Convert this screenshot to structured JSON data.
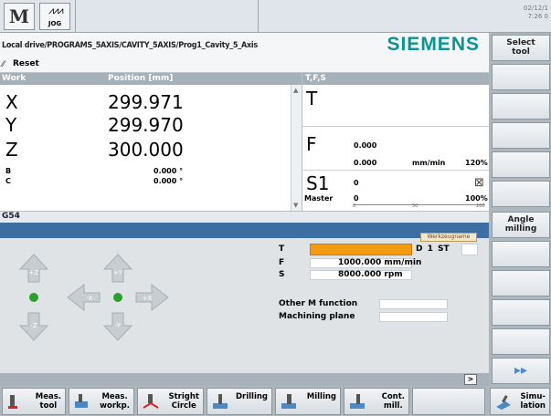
{
  "header": {
    "mode_icon": "M",
    "jog_label": "JOG",
    "date": "02/12/1",
    "time": "7:26 0"
  },
  "path": {
    "text": "Local drive/PROGRAMS_5AXIS/CAVITY_5AXIS/Prog1_Cavity_5_Axis",
    "brand": "SIEMENS",
    "reset": "Reset"
  },
  "work": {
    "header_work": "Work",
    "header_position": "Position [mm]",
    "axes": [
      {
        "name": "X",
        "value": "299.971"
      },
      {
        "name": "Y",
        "value": "299.970"
      },
      {
        "name": "Z",
        "value": "300.000"
      }
    ],
    "rot_axes": [
      {
        "name": "B",
        "value": "0.000 °"
      },
      {
        "name": "C",
        "value": "0.000 °"
      }
    ]
  },
  "tfs": {
    "header": "T,F,S",
    "t_label": "T",
    "f_label": "F",
    "f_actual": "0.000",
    "f_set": "0.000",
    "f_unit": "mm/min",
    "f_percent": "120%",
    "s_label": "S1",
    "s_actual": "0",
    "master_label": "Master",
    "master_value": "0",
    "s_percent": "100%",
    "scale_mid": "50",
    "scale_max": "100",
    "scale_min": "0"
  },
  "g54": "G54",
  "tool_input": {
    "badge": "Werkzeugname",
    "t_label": "T",
    "d_label": "D",
    "d_value": "1",
    "st_label": "ST",
    "f_label": "F",
    "f_value": "1000.000",
    "f_unit": "mm/min",
    "s_label": "S",
    "s_value": "8000.000",
    "s_unit": "rpm",
    "m_label": "Other M function",
    "plane_label": "Machining plane"
  },
  "right_softkeys": [
    {
      "label": "Select\ntool"
    },
    {
      "label": ""
    },
    {
      "label": ""
    },
    {
      "label": ""
    },
    {
      "label": ""
    },
    {
      "label": ""
    },
    {
      "label": "Angle\nmilling"
    },
    {
      "label": ""
    },
    {
      "label": ""
    },
    {
      "label": ""
    },
    {
      "label": ""
    },
    {
      "label": "▸▸"
    }
  ],
  "bottom_softkeys": [
    {
      "label": "Meas.\ntool",
      "icon": "measure-tool-icon"
    },
    {
      "label": "Meas.\nworkp.",
      "icon": "measure-workpiece-icon"
    },
    {
      "label": "Stright\nCircle",
      "icon": "straight-circle-icon"
    },
    {
      "label": "Drilling",
      "icon": "drilling-icon"
    },
    {
      "label": "Milling",
      "icon": "milling-icon"
    },
    {
      "label": "Cont.\nmill.",
      "icon": "contour-milling-icon"
    },
    {
      "label": "",
      "icon": ""
    },
    {
      "label": "Simu-\nlation",
      "icon": "simulation-icon"
    }
  ],
  "colors": {
    "accent_teal": "#0b9396",
    "header_gray": "#a6b0b8",
    "tool_orange": "#f39a13",
    "blue_band": "#3d6ea2",
    "jog_green": "#2aa12a"
  }
}
